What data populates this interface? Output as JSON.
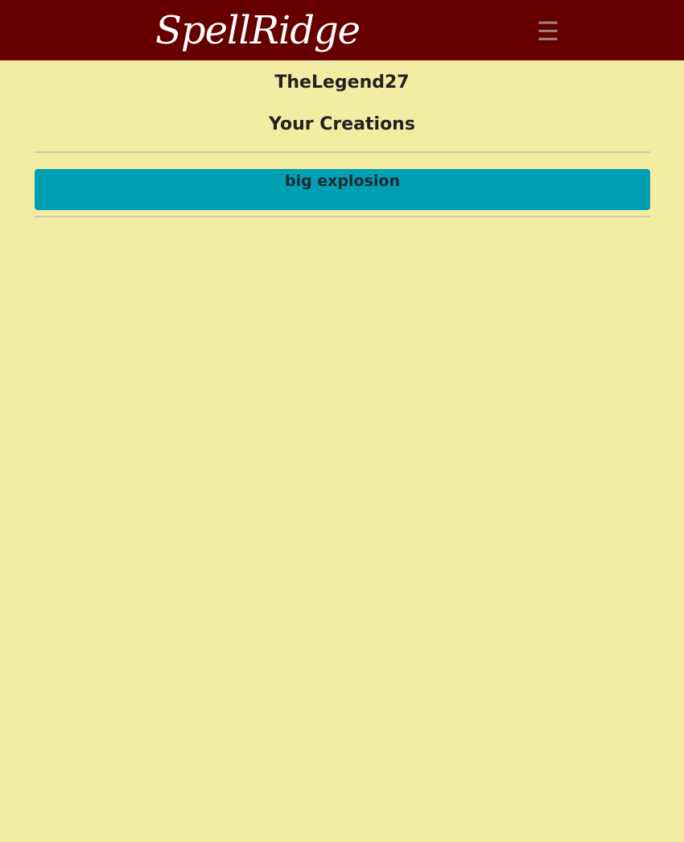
{
  "navbar": {
    "brand": "SpellRidge",
    "menu_icon": "hamburger-menu-icon",
    "menu_glyph": "☰",
    "background": "#660000"
  },
  "profile": {
    "username": "TheLegend27"
  },
  "creations": {
    "heading": "Your Creations",
    "items": [
      {
        "title": "big explosion"
      }
    ],
    "card_color": "#009fb4"
  },
  "page": {
    "background": "#f5eca4"
  }
}
